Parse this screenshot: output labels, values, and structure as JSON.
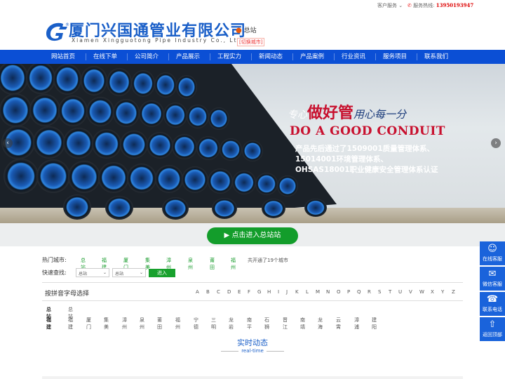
{
  "topbar": {
    "customer_service": "客户服务 ⌄",
    "hotline_label": "服务热线:",
    "hotline_number": "13950193947"
  },
  "header": {
    "company_name": "厦门兴国通管业有限公司",
    "company_name_en": "Xiamen Xingguotong Pipe Industry Co., Ltd.",
    "location": "总站",
    "switch_city": "[切换城市]"
  },
  "nav": {
    "items": [
      "网站首页",
      "在线下单",
      "公司简介",
      "产品展示",
      "工程实力",
      "新闻动态",
      "产品案例",
      "行业资讯",
      "服务项目",
      "联系我们"
    ]
  },
  "banner": {
    "slogan_a": "专心",
    "slogan_b": "做好管",
    "slogan_c": "用心每一分",
    "slogan_en": "DO A GOOD CONDUIT",
    "cert_lines": [
      "产品先后通过了1509001质量管理体系、",
      "15014001环境管理体系、",
      "OHSAS18001职业健康安全管理体系认证"
    ]
  },
  "enter": {
    "label": "点击进入总站站"
  },
  "hot_cities": {
    "label": "热门城市:",
    "cities": [
      "总站",
      "福建",
      "厦门",
      "集美",
      "漳州",
      "泉州",
      "莆田",
      "福州"
    ],
    "note": "共开通了19个城市"
  },
  "quick_search": {
    "label": "快速查找:",
    "select1": "总站",
    "select2": "总站",
    "button": "进入"
  },
  "pinyin": {
    "title": "按拼音字母选择",
    "letters": [
      "A",
      "B",
      "C",
      "D",
      "E",
      "F",
      "G",
      "H",
      "I",
      "J",
      "K",
      "L",
      "M",
      "N",
      "O",
      "P",
      "Q",
      "R",
      "S",
      "T",
      "U",
      "V",
      "W",
      "X",
      "Y",
      "Z"
    ]
  },
  "city_rows": [
    {
      "label": "总站",
      "cities": [
        "总站"
      ]
    },
    {
      "label": "福建",
      "cities": [
        "福建",
        "厦门",
        "集美",
        "漳州",
        "泉州",
        "莆田",
        "福州",
        "宁德",
        "三明",
        "龙岩",
        "南平",
        "石狮",
        "晋江",
        "南靖",
        "龙海",
        "云霄",
        "漳浦",
        "建阳"
      ]
    }
  ],
  "news": {
    "title": "实时动态",
    "subtitle": "real-time"
  },
  "float_bar": [
    {
      "icon": "qq-icon",
      "label": "在线客服"
    },
    {
      "icon": "wechat-icon",
      "label": "微信客服"
    },
    {
      "icon": "phone-icon",
      "label": "联系电话"
    },
    {
      "icon": "top-icon",
      "label": "返回顶部"
    }
  ],
  "colors": {
    "brand_blue": "#0b4fd5",
    "green": "#139d2b",
    "red": "#c8102e"
  }
}
